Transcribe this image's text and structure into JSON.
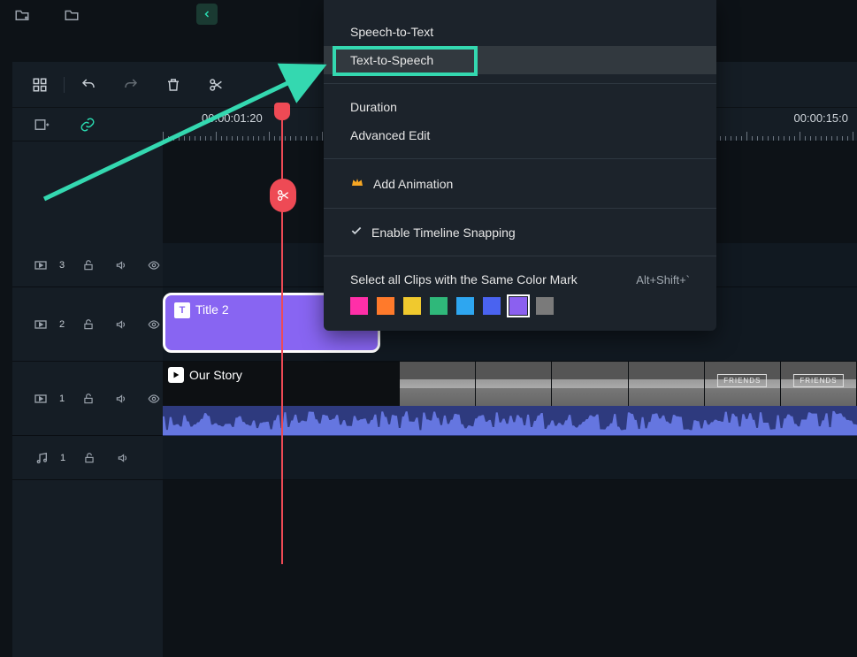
{
  "ruler": {
    "tc_left": "00:00:01:20",
    "tc_right": "00:00:15:0"
  },
  "menu": {
    "speech_to_text": "Speech-to-Text",
    "text_to_speech": "Text-to-Speech",
    "duration": "Duration",
    "advanced_edit": "Advanced Edit",
    "add_animation": "Add Animation",
    "timeline_snapping": "Enable Timeline Snapping",
    "select_color_mark": "Select all Clips with the Same Color Mark",
    "select_color_mark_shortcut": "Alt+Shift+`",
    "swatches": [
      "#ff2fa8",
      "#ff7a2b",
      "#f0c92e",
      "#2fb87a",
      "#2ea6f0",
      "#4a63f0",
      "#8b60f0",
      "#7a7a7a"
    ]
  },
  "tracks": {
    "t3_num": "3",
    "t2_num": "2",
    "t1_num": "1",
    "audio_num": "1"
  },
  "clips": {
    "title_label": "Title 2",
    "video_label": "Our Story",
    "thumb_labels": [
      "",
      "",
      "",
      "",
      "FRIENDS",
      "FRIENDS"
    ]
  }
}
